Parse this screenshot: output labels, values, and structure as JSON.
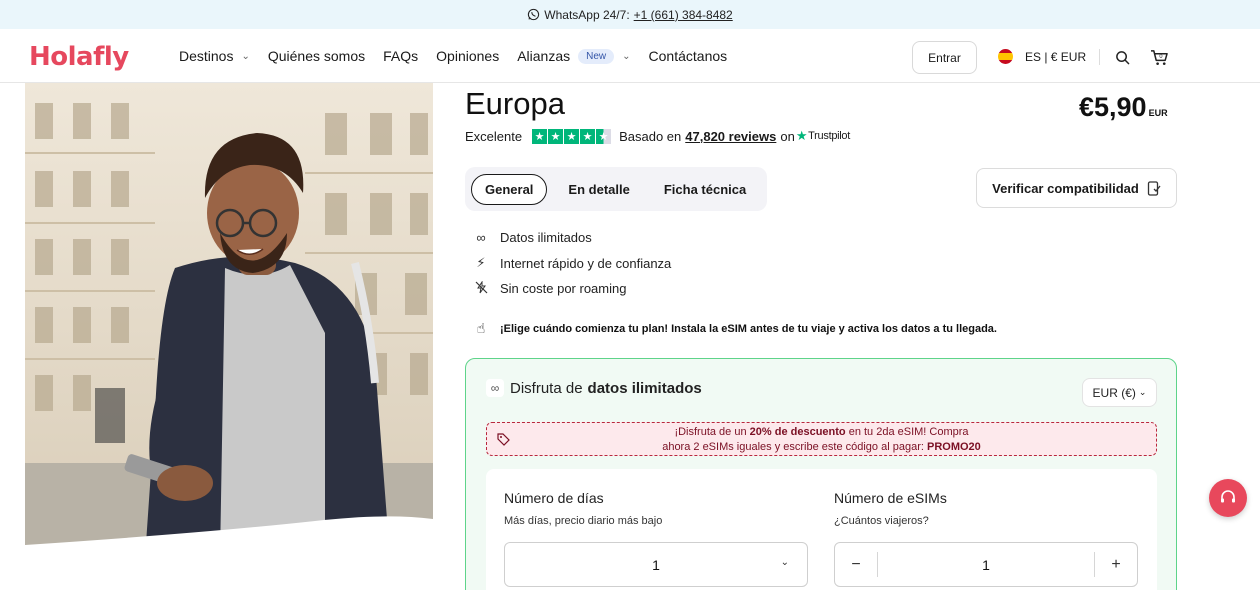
{
  "topbar": {
    "label": "WhatsApp 24/7:",
    "phone": "+1 (661) 384-8482"
  },
  "header": {
    "logo": "Holafly",
    "nav": [
      {
        "label": "Destinos",
        "has_dropdown": true
      },
      {
        "label": "Quiénes somos"
      },
      {
        "label": "FAQs"
      },
      {
        "label": "Opiniones"
      },
      {
        "label": "Alianzas",
        "badge": "New",
        "has_dropdown": true
      },
      {
        "label": "Contáctanos"
      }
    ],
    "login_label": "Entrar",
    "locale": "ES | € EUR"
  },
  "product": {
    "title": "Europa",
    "price": "€5,90",
    "price_currency": "EUR",
    "rating_label": "Excelente",
    "reviews_prefix": "Basado en",
    "reviews_count": "47,820 reviews",
    "reviews_on": "on",
    "trustpilot": "Trustpilot",
    "stars": 4.5
  },
  "tabs": [
    {
      "label": "General",
      "active": true
    },
    {
      "label": "En detalle"
    },
    {
      "label": "Ficha técnica"
    }
  ],
  "compat_button": "Verificar compatibilidad",
  "features": [
    {
      "icon": "infinity-icon",
      "label": "Datos ilimitados"
    },
    {
      "icon": "lightning-icon",
      "label": "Internet rápido y de confianza"
    },
    {
      "icon": "no-roaming-icon",
      "label": "Sin coste por roaming"
    }
  ],
  "notice": "¡Elige cuándo comienza tu plan! Instala la eSIM antes de tu viaje y activa los datos a tu llegada.",
  "plan_card": {
    "title_prefix": "Disfruta de",
    "title_bold": "datos ilimitados",
    "currency_select": "EUR (€)",
    "promo": {
      "line1_prefix": "¡Disfruta de un",
      "line1_bold": "20% de descuento",
      "line1_suffix": "en tu 2da eSIM! Compra",
      "line2_prefix": "ahora 2 eSIMs iguales y escribe este código al pagar:",
      "code": "PROMO20"
    },
    "days": {
      "label": "Número de días",
      "sub": "Más días, precio diario más bajo",
      "value": "1"
    },
    "esims": {
      "label": "Número de eSIMs",
      "sub": "¿Cuántos viajeros?",
      "value": "1",
      "minus": "−",
      "plus": "+"
    }
  },
  "colors": {
    "brand": "#e6485e",
    "trustpilot_green": "#00b67a",
    "card_border": "#5ed48a",
    "promo_text": "#7b1024"
  }
}
